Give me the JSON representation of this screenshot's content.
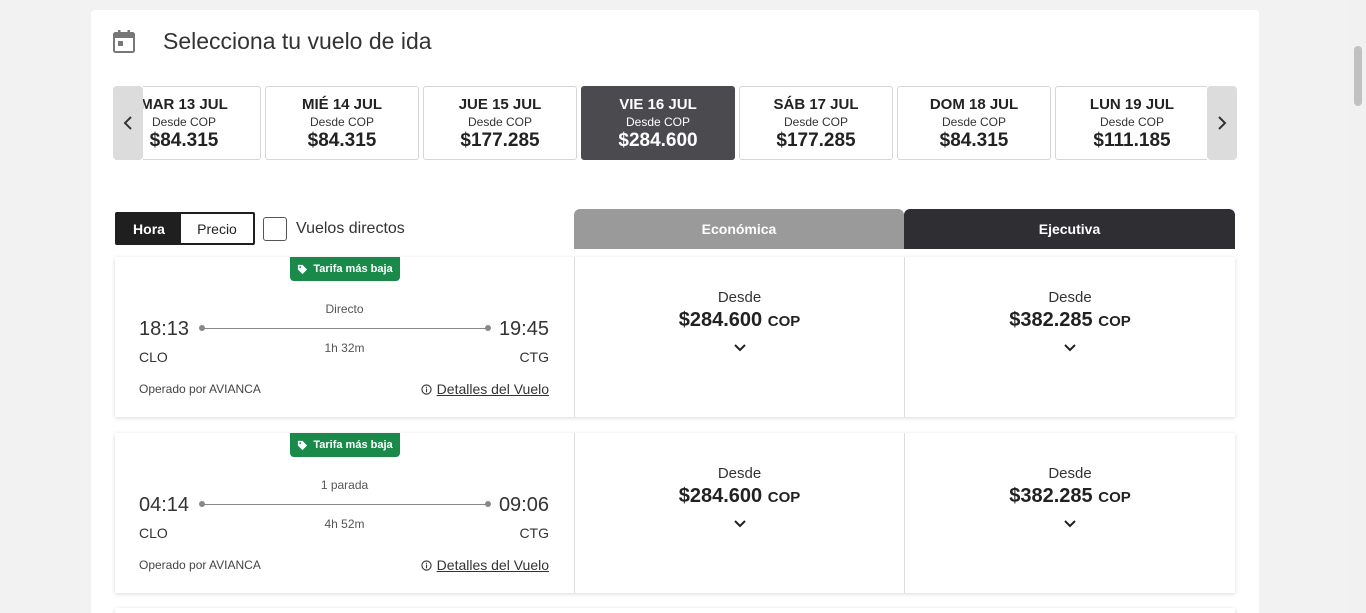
{
  "header": {
    "title": "Selecciona tu vuelo de ida",
    "icon": "calendar-icon"
  },
  "date_strip": {
    "days": [
      {
        "label": "MAR 13 JUL",
        "sub": "Desde COP",
        "price": "$84.315",
        "selected": false
      },
      {
        "label": "MIÉ 14 JUL",
        "sub": "Desde COP",
        "price": "$84.315",
        "selected": false
      },
      {
        "label": "JUE 15 JUL",
        "sub": "Desde COP",
        "price": "$177.285",
        "selected": false
      },
      {
        "label": "VIE 16 JUL",
        "sub": "Desde COP",
        "price": "$284.600",
        "selected": true
      },
      {
        "label": "SÁB 17 JUL",
        "sub": "Desde COP",
        "price": "$177.285",
        "selected": false
      },
      {
        "label": "DOM 18 JUL",
        "sub": "Desde COP",
        "price": "$84.315",
        "selected": false
      },
      {
        "label": "LUN 19 JUL",
        "sub": "Desde COP",
        "price": "$111.185",
        "selected": false
      }
    ]
  },
  "filters": {
    "sort_hora": "Hora",
    "sort_precio": "Precio",
    "direct_label": "Vuelos directos"
  },
  "cabins": {
    "economy": "Económica",
    "executive": "Ejecutiva"
  },
  "flights": [
    {
      "badge": "Tarifa más baja",
      "stops": "Directo",
      "departure": "18:13",
      "arrival": "19:45",
      "duration": "1h 32m",
      "origin": "CLO",
      "destination": "CTG",
      "operator": "Operado por AVIANCA",
      "details": "Detalles del Vuelo",
      "economy": {
        "from": "Desde",
        "price": "$284.600",
        "currency": "COP"
      },
      "executive": {
        "from": "Desde",
        "price": "$382.285",
        "currency": "COP"
      }
    },
    {
      "badge": "Tarifa más baja",
      "stops": "1 parada",
      "departure": "04:14",
      "arrival": "09:06",
      "duration": "4h 52m",
      "origin": "CLO",
      "destination": "CTG",
      "operator": "Operado por AVIANCA",
      "details": "Detalles del Vuelo",
      "economy": {
        "from": "Desde",
        "price": "$284.600",
        "currency": "COP"
      },
      "executive": {
        "from": "Desde",
        "price": "$382.285",
        "currency": "COP"
      }
    }
  ],
  "colors": {
    "badge_green": "#1a8a4a",
    "selected_day": "#4b4b4f",
    "executive_tab": "#2f2f33",
    "economy_tab": "#9a9a9a"
  }
}
